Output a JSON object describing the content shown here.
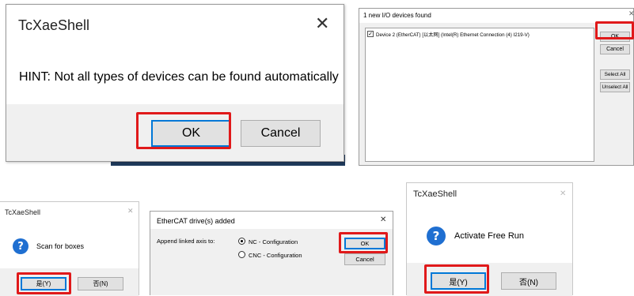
{
  "hint_dialog": {
    "title": "TcXaeShell",
    "message": "HINT: Not all types of devices can be found automatically",
    "ok_label": "OK",
    "cancel_label": "Cancel"
  },
  "devices_dialog": {
    "title": "1 new I/O devices found",
    "device_item": "Device 2 (EtherCAT)   [以太网] (Intel(R) Ethernet Connection (4) I219-V)",
    "ok_label": "OK",
    "cancel_label": "Cancel",
    "select_all_label": "Select All",
    "unselect_all_label": "Unselect All"
  },
  "scan_dialog": {
    "title": "TcXaeShell",
    "message": "Scan for boxes",
    "yes_label": "是(Y)",
    "no_label": "否(N)"
  },
  "ethercat_dialog": {
    "title": "EtherCAT drive(s) added",
    "append_label": "Append linked axis to:",
    "option_nc": "NC - Configuration",
    "option_cnc": "CNC - Configuration",
    "ok_label": "OK",
    "cancel_label": "Cancel"
  },
  "freerun_dialog": {
    "title": "TcXaeShell",
    "message": "Activate Free Run",
    "yes_label": "是(Y)",
    "no_label": "否(N)"
  }
}
